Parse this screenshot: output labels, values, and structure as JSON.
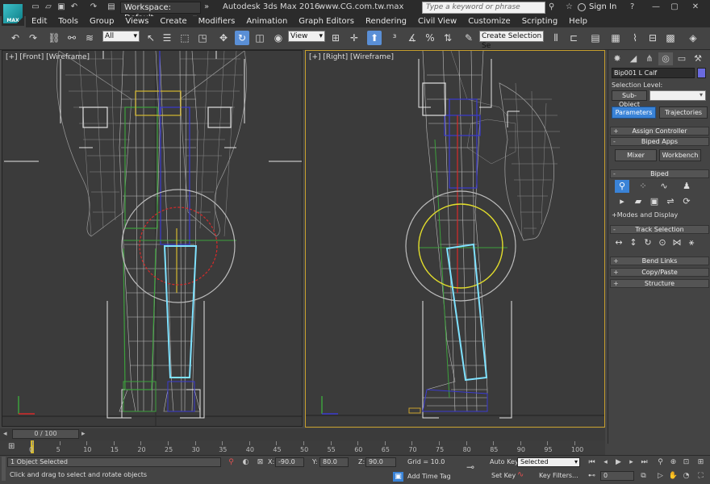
{
  "app": {
    "title": "Autodesk 3ds Max 2016",
    "website": "www.CG.com.tw.max",
    "logo_text": "MAX",
    "workspace": "Workspace: Default",
    "search_placeholder": "Type a keyword or phrase",
    "sign_in": "Sign In"
  },
  "menu": [
    "Edit",
    "Tools",
    "Group",
    "Views",
    "Create",
    "Modifiers",
    "Animation",
    "Graph Editors",
    "Rendering",
    "Civil View",
    "Customize",
    "Scripting",
    "Help"
  ],
  "toolbar": {
    "selection_filter": "All",
    "ref_coord": "View",
    "named_selection": "Create Selection Se"
  },
  "viewports": {
    "front_label": "[+] [Front] [Wireframe]",
    "right_label": "[+] [Right] [Wireframe]"
  },
  "command_panel": {
    "object_name": "Bip001 L Calf",
    "object_color": "#6a6adf",
    "selection_level_label": "Selection Level:",
    "sub_object": "Sub-Object",
    "tabs": [
      "Parameters",
      "Trajectories"
    ],
    "rollouts": {
      "assign_controller": "Assign Controller",
      "biped_apps": "Biped Apps",
      "mixer": "Mixer",
      "workbench": "Workbench",
      "biped": "Biped",
      "modes_display": "Modes and Display",
      "track_selection": "Track Selection",
      "bend_links": "Bend Links",
      "copy_paste": "Copy/Paste",
      "structure": "Structure"
    }
  },
  "timeline": {
    "slider_text": "0 / 100",
    "ticks": [
      "0",
      "5",
      "10",
      "15",
      "20",
      "25",
      "30",
      "35",
      "40",
      "45",
      "50",
      "55",
      "60",
      "65",
      "70",
      "75",
      "80",
      "85",
      "90",
      "95",
      "100"
    ]
  },
  "status": {
    "selection": "1 Object Selected",
    "prompt": "Click and drag to select and rotate objects",
    "x_label": "X:",
    "x_value": "-90.0",
    "y_label": "Y:",
    "y_value": "80.0",
    "z_label": "Z:",
    "z_value": "90.0",
    "grid": "Grid = 10.0",
    "add_time_tag": "Add Time Tag",
    "auto_key": "Auto Key",
    "set_key": "Set Key",
    "key_mode": "Selected",
    "key_filters": "Key Filters...",
    "frame": "0"
  }
}
